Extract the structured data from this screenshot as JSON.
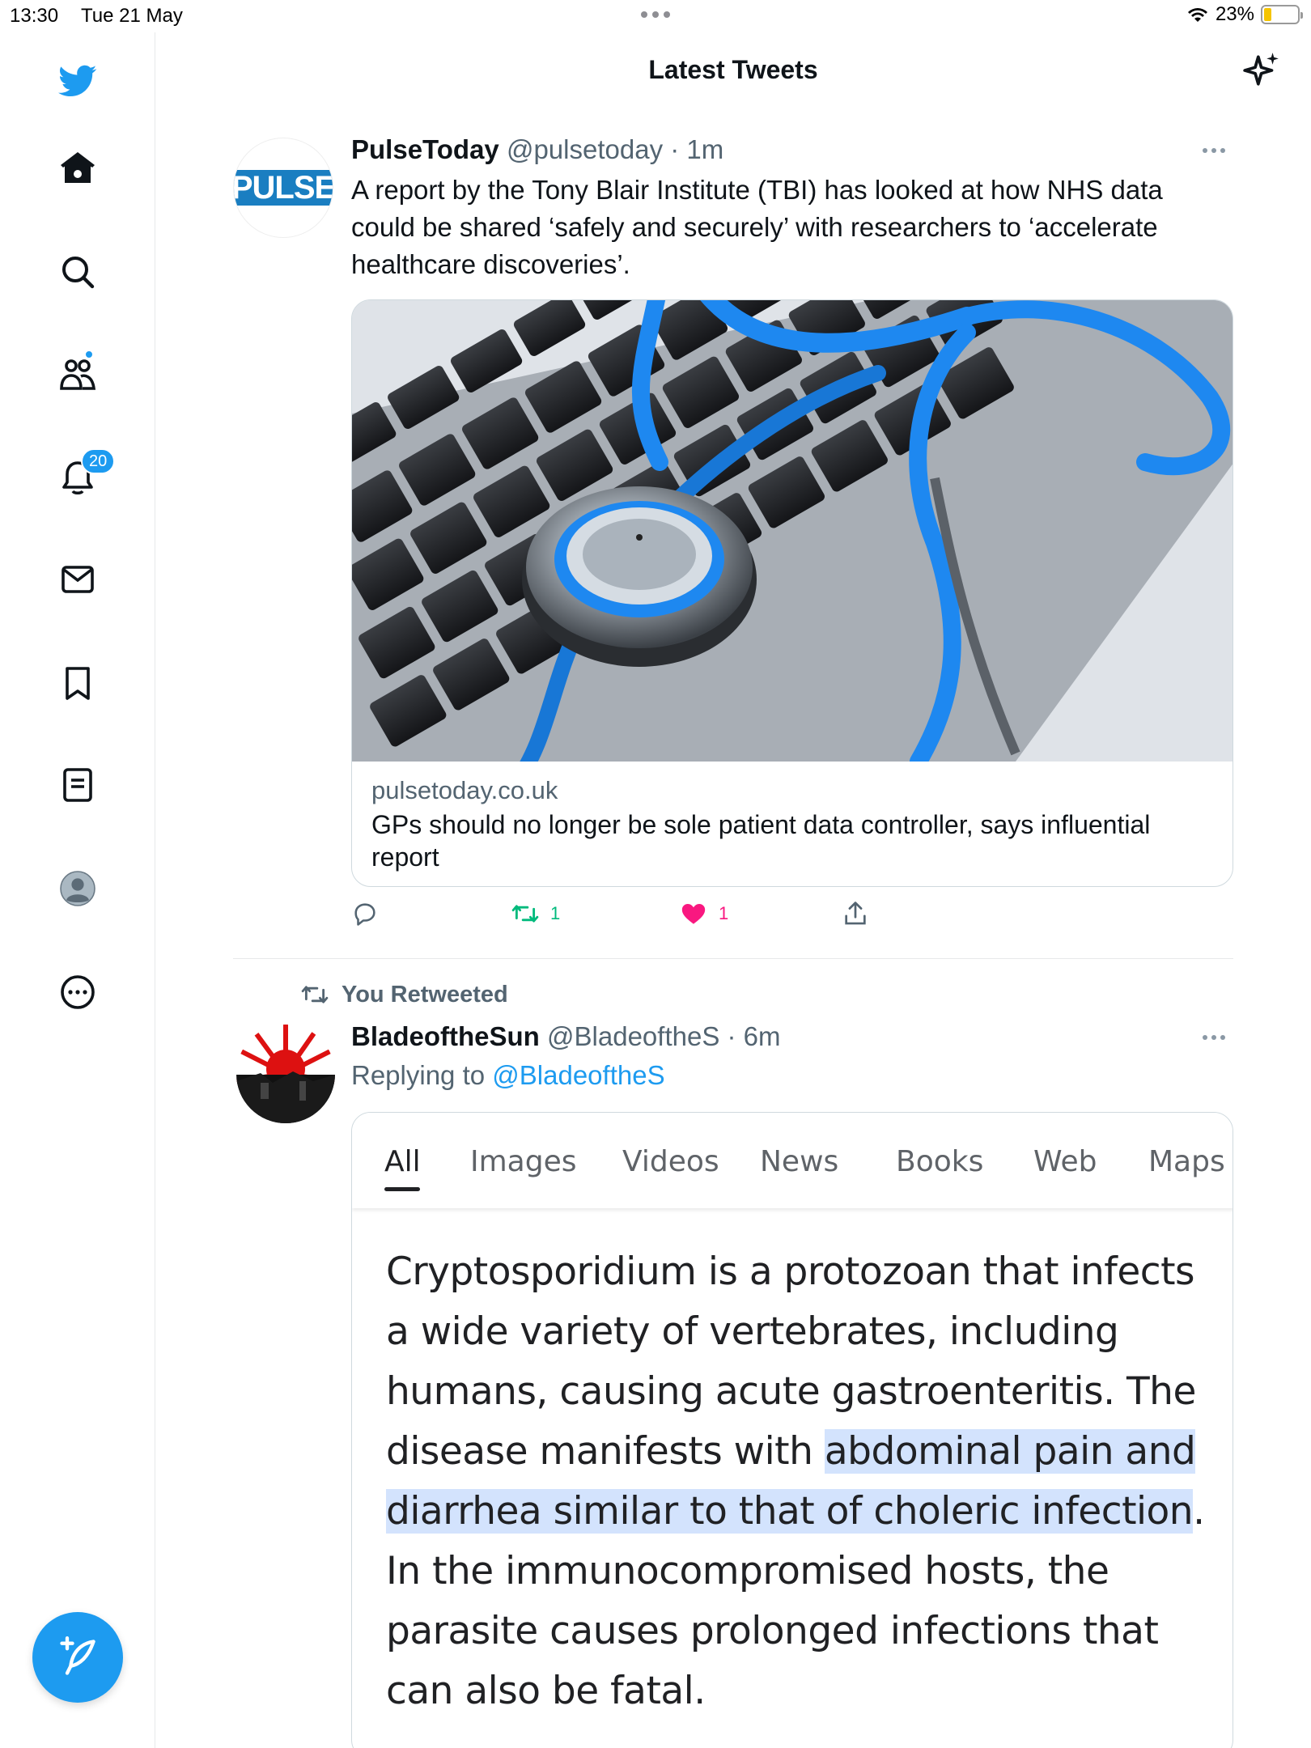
{
  "status_bar": {
    "time": "13:30",
    "date": "Tue 21 May",
    "battery": "23%",
    "battery_level": 0.23,
    "battery_color": "#f5c400"
  },
  "sidebar": {
    "logo_icon": "twitter-bird-icon",
    "items": [
      {
        "name": "home",
        "icon": "home-icon"
      },
      {
        "name": "explore",
        "icon": "search-icon"
      },
      {
        "name": "communities",
        "icon": "communities-icon",
        "has_dot": true
      },
      {
        "name": "notifications",
        "icon": "bell-icon",
        "badge": "20"
      },
      {
        "name": "messages",
        "icon": "mail-icon"
      },
      {
        "name": "bookmarks",
        "icon": "bookmark-icon"
      },
      {
        "name": "lists",
        "icon": "list-icon"
      },
      {
        "name": "profile",
        "icon": "avatar-icon"
      },
      {
        "name": "more",
        "icon": "more-circle-icon"
      }
    ],
    "compose_icon": "compose-icon",
    "accent": "#1d9bf0"
  },
  "header": {
    "title": "Latest Tweets",
    "sparkle_icon": "sparkle-icon"
  },
  "tweets": [
    {
      "avatar_text": "PULSE",
      "name": "PulseToday",
      "handle": "@pulsetoday",
      "sep": " · ",
      "time": "1m",
      "text_lines": [
        "A report by the Tony Blair Institute (TBI) has looked at how NHS data",
        "could be shared ‘safely and securely’ with researchers to ‘accelerate",
        "healthcare discoveries’."
      ],
      "card": {
        "image_alt": "stethoscope-on-laptop-keyboard",
        "domain": "pulsetoday.co.uk",
        "title": "GPs should no longer be sole patient data controller, says influential report"
      },
      "actions": {
        "retweets": "1",
        "likes": "1",
        "retweet_color": "#00ba7c",
        "like_color": "#f91880"
      }
    },
    {
      "retweeted_label": "You Retweeted",
      "name": "BladeoftheSun",
      "handle": "@BladeoftheS",
      "sep": " · ",
      "time": "6m",
      "reply_prefix": "Replying to ",
      "reply_to": "@BladeoftheS",
      "screenshot": {
        "tabs": [
          "All",
          "Images",
          "Videos",
          "News",
          "Books",
          "Web",
          "Maps"
        ],
        "active_tab": "All",
        "text_before": "Cryptosporidium is a protozoan that infects a wide variety of vertebrates, including humans, causing acute gastroenteritis. The disease manifests with ",
        "text_highlight": "abdominal pain and diarrhea similar to that of choleric infection",
        "text_after": ". In the immunocompromised hosts, the parasite causes prolonged infections that can also be fatal.",
        "highlight_color": "#d3e3fd"
      }
    }
  ]
}
